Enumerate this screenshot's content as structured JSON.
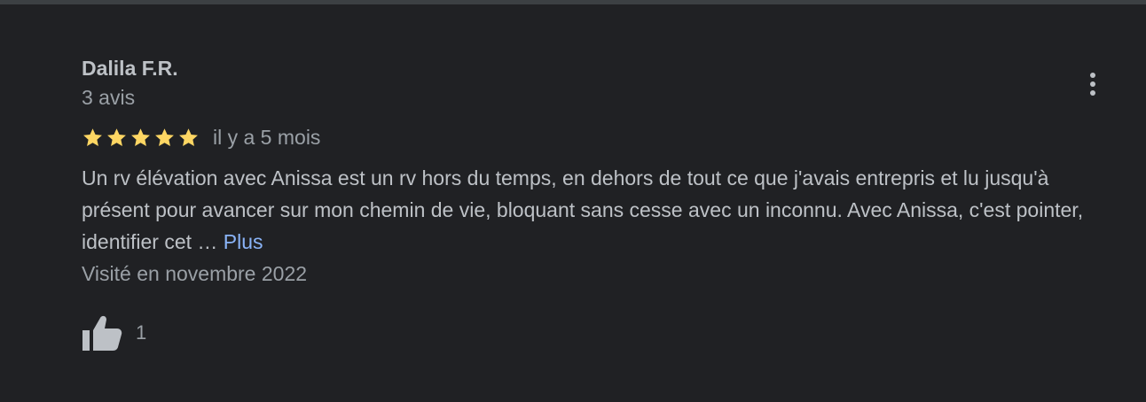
{
  "review": {
    "author": "Dalila F.R.",
    "review_count": "3 avis",
    "rating": 5,
    "rating_max": 5,
    "time_ago": "il y a 5 mois",
    "text": "Un rv élévation avec Anissa est un rv hors du temps, en dehors de tout ce que j'avais entrepris et lu jusqu'à présent pour avancer sur mon chemin de vie, bloquant sans cesse avec un inconnu. Avec Anissa, c'est pointer, identifier cet … ",
    "more_label": "Plus",
    "visited": "Visité en novembre 2022",
    "likes": "1"
  },
  "icons": {
    "star": "star-icon",
    "like": "thumbs-up-icon",
    "menu": "more-vert-icon"
  },
  "colors": {
    "background": "#202124",
    "star": "#fdd663",
    "link": "#8ab4f8",
    "primary_text": "#bdc1c6",
    "secondary_text": "#9aa0a6"
  }
}
